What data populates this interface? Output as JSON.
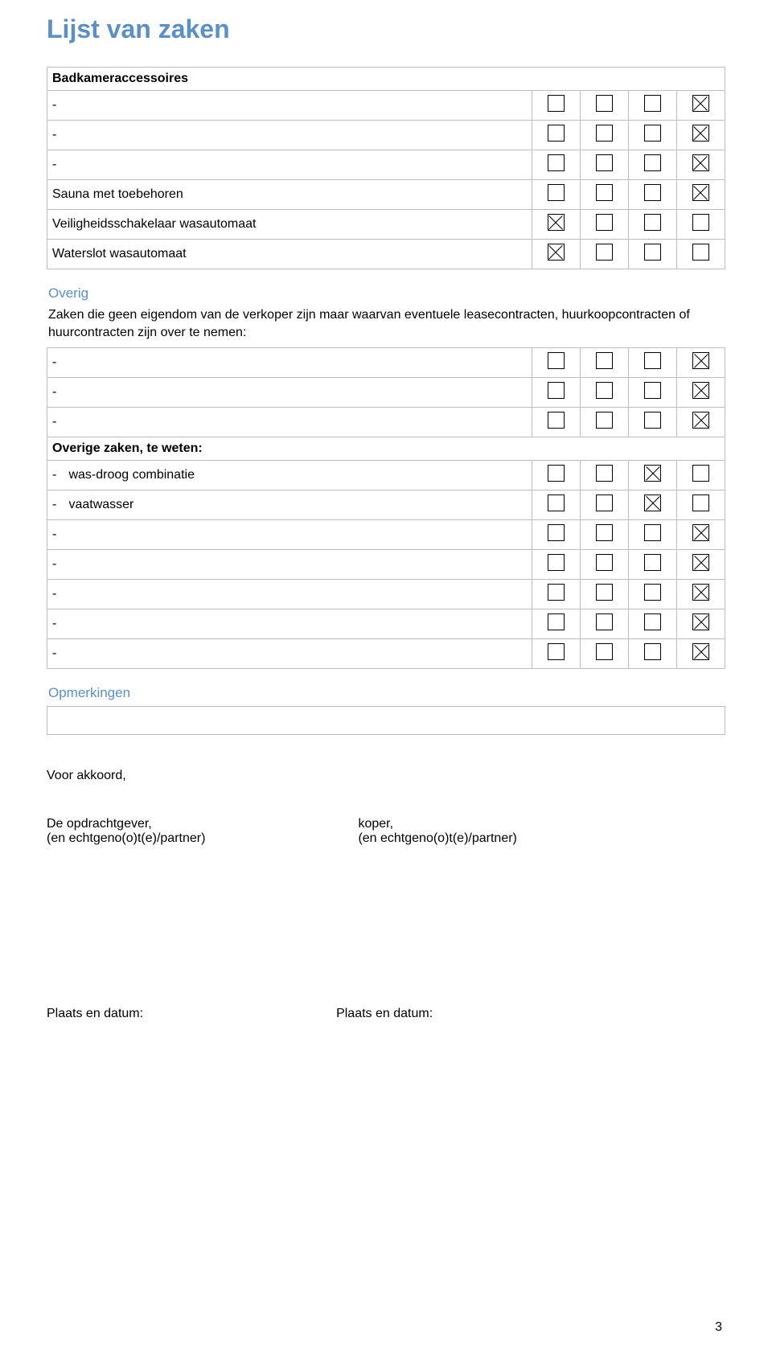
{
  "title": "Lijst van zaken",
  "section1_header": "Badkameraccessoires",
  "section1_rows": [
    {
      "label": "-",
      "checks": [
        0,
        0,
        0,
        1
      ]
    },
    {
      "label": "-",
      "checks": [
        0,
        0,
        0,
        1
      ]
    },
    {
      "label": "-",
      "checks": [
        0,
        0,
        0,
        1
      ]
    },
    {
      "label": "Sauna met toebehoren",
      "checks": [
        0,
        0,
        0,
        1
      ]
    },
    {
      "label": "Veiligheidsschakelaar wasautomaat",
      "checks": [
        1,
        0,
        0,
        0
      ]
    },
    {
      "label": "Waterslot wasautomaat",
      "checks": [
        1,
        0,
        0,
        0
      ]
    }
  ],
  "overig_header": "Overig",
  "overig_intro": "Zaken die geen eigendom van de verkoper zijn maar waarvan eventuele leasecontracten, huurkoopcontracten of huurcontracten zijn over te nemen:",
  "section2_rows": [
    {
      "label": "-",
      "checks": [
        0,
        0,
        0,
        1
      ]
    },
    {
      "label": "-",
      "checks": [
        0,
        0,
        0,
        1
      ]
    },
    {
      "label": "-",
      "checks": [
        0,
        0,
        0,
        1
      ]
    }
  ],
  "overige_zaken_header": "Overige zaken, te weten:",
  "section3_rows": [
    {
      "label": "was-droog combinatie",
      "indent": true,
      "checks": [
        0,
        0,
        1,
        0
      ]
    },
    {
      "label": "vaatwasser",
      "indent": true,
      "checks": [
        0,
        0,
        1,
        0
      ]
    },
    {
      "label": "-",
      "checks": [
        0,
        0,
        0,
        1
      ]
    },
    {
      "label": "-",
      "checks": [
        0,
        0,
        0,
        1
      ]
    },
    {
      "label": "-",
      "checks": [
        0,
        0,
        0,
        1
      ]
    },
    {
      "label": "-",
      "checks": [
        0,
        0,
        0,
        1
      ]
    },
    {
      "label": "-",
      "checks": [
        0,
        0,
        0,
        1
      ]
    }
  ],
  "opmerkingen_header": "Opmerkingen",
  "akkoord": "Voor akkoord,",
  "sig_left_1": "De opdrachtgever,",
  "sig_left_2": "(en echtgeno(o)t(e)/partner)",
  "sig_right_1": "koper,",
  "sig_right_2": "(en echtgeno(o)t(e)/partner)",
  "place_date_left": "Plaats en datum:",
  "place_date_right": "Plaats en datum:",
  "page_number": "3"
}
